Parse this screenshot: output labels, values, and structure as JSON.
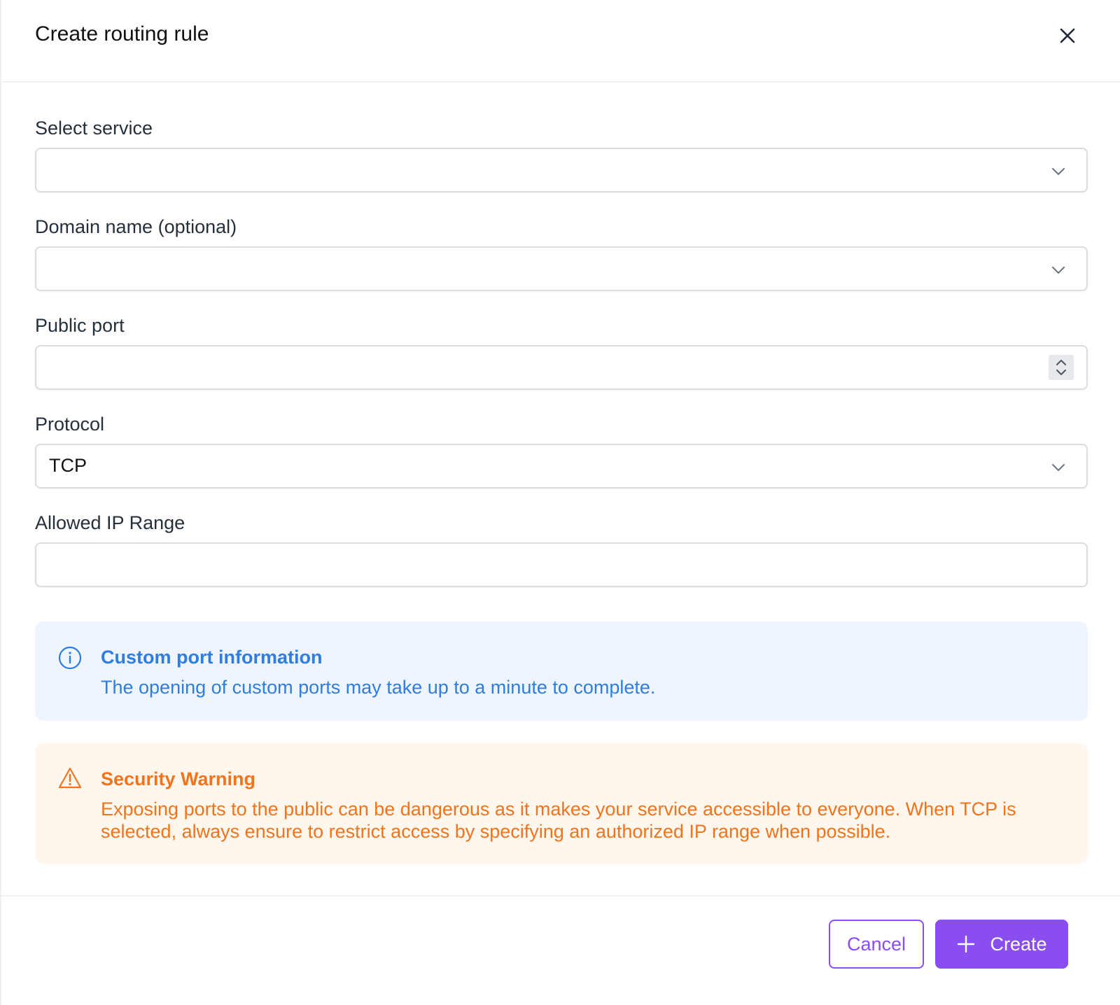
{
  "dialog": {
    "title": "Create routing rule"
  },
  "fields": {
    "service": {
      "label": "Select service",
      "value": ""
    },
    "domain": {
      "label": "Domain name (optional)",
      "value": ""
    },
    "port": {
      "label": "Public port",
      "value": ""
    },
    "protocol": {
      "label": "Protocol",
      "value": "TCP"
    },
    "ip_range": {
      "label": "Allowed IP Range",
      "value": ""
    }
  },
  "alerts": {
    "info": {
      "title": "Custom port information",
      "text": "The opening of custom ports may take up to a minute to complete.",
      "icon": "info-circle-icon",
      "color": "#2f7de1",
      "background": "#eef5fe"
    },
    "warning": {
      "title": "Security Warning",
      "text": "Exposing ports to the public can be dangerous as it makes your service accessible to everyone. When TCP is selected, always ensure to restrict access by specifying an authorized IP range when possible.",
      "icon": "warning-triangle-icon",
      "color": "#f1741c",
      "background": "#fff6ee"
    }
  },
  "footer": {
    "cancel_label": "Cancel",
    "create_label": "Create"
  },
  "colors": {
    "accent": "#8a4df0"
  }
}
